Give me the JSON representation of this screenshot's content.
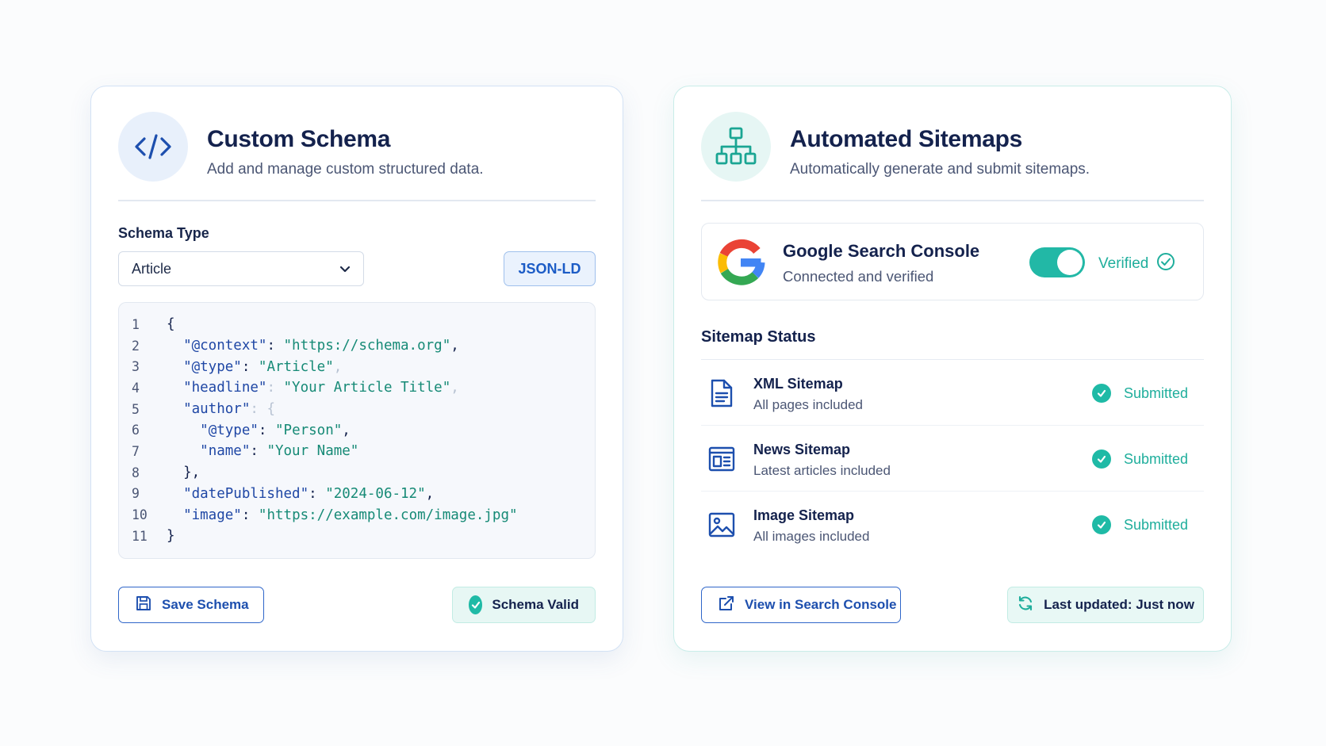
{
  "schema_card": {
    "title": "Custom Schema",
    "subtitle": "Add and manage custom structured data.",
    "icon": "code-icon",
    "schema_type_label": "Schema Type",
    "schema_type_value": "Article",
    "format_badge": "JSON-LD",
    "code_lines": [
      {
        "n": "1",
        "indent": "",
        "parts": [
          [
            "p",
            "{"
          ]
        ]
      },
      {
        "n": "2",
        "indent": "  ",
        "parts": [
          [
            "k",
            "\"@context\""
          ],
          [
            "p",
            ": "
          ],
          [
            "s",
            "\"https://schema.org\""
          ],
          [
            "p",
            ","
          ]
        ]
      },
      {
        "n": "3",
        "indent": "  ",
        "parts": [
          [
            "k",
            "\"@type\""
          ],
          [
            "p",
            ": "
          ],
          [
            "s",
            "\"Article\""
          ],
          [
            "fade",
            ","
          ]
        ]
      },
      {
        "n": "4",
        "indent": "  ",
        "parts": [
          [
            "k",
            "\"headline\""
          ],
          [
            "fade",
            ": "
          ],
          [
            "s",
            "\"Your Article Title\""
          ],
          [
            "fade",
            ","
          ]
        ]
      },
      {
        "n": "5",
        "indent": "  ",
        "parts": [
          [
            "k",
            "\"author\""
          ],
          [
            "fade",
            ": {"
          ]
        ]
      },
      {
        "n": "6",
        "indent": "    ",
        "parts": [
          [
            "k",
            "\"@type\""
          ],
          [
            "p",
            ": "
          ],
          [
            "s",
            "\"Person\""
          ],
          [
            "p",
            ","
          ]
        ]
      },
      {
        "n": "7",
        "indent": "    ",
        "parts": [
          [
            "k",
            "\"name\""
          ],
          [
            "p",
            ": "
          ],
          [
            "s",
            "\"Your Name\""
          ]
        ]
      },
      {
        "n": "8",
        "indent": "  ",
        "parts": [
          [
            "p",
            "},"
          ]
        ]
      },
      {
        "n": "9",
        "indent": "  ",
        "parts": [
          [
            "k",
            "\"datePublished\""
          ],
          [
            "p",
            ": "
          ],
          [
            "s",
            "\"2024-06-12\""
          ],
          [
            "p",
            ","
          ]
        ]
      },
      {
        "n": "10",
        "indent": "  ",
        "parts": [
          [
            "k",
            "\"image\""
          ],
          [
            "p",
            ": "
          ],
          [
            "s",
            "\"https://example.com/image.jpg\""
          ]
        ]
      },
      {
        "n": "11",
        "indent": "",
        "parts": [
          [
            "p",
            "}"
          ]
        ]
      }
    ],
    "save_button": "Save Schema",
    "valid_badge": "Schema Valid"
  },
  "sitemaps_card": {
    "title": "Automated Sitemaps",
    "subtitle": "Automatically generate and submit sitemaps.",
    "icon": "sitemap-icon",
    "gsc": {
      "title": "Google Search Console",
      "subtitle": "Connected and verified",
      "toggle_on": true,
      "status": "Verified"
    },
    "section_title": "Sitemap Status",
    "sitemaps": [
      {
        "name": "XML Sitemap",
        "desc": "All pages included",
        "status": "Submitted",
        "icon": "document-icon"
      },
      {
        "name": "News Sitemap",
        "desc": "Latest articles included",
        "status": "Submitted",
        "icon": "news-icon"
      },
      {
        "name": "Image Sitemap",
        "desc": "All images included",
        "status": "Submitted",
        "icon": "image-icon"
      }
    ],
    "view_button": "View in Search Console",
    "updated_badge": "Last updated: Just now"
  },
  "colors": {
    "primary_blue": "#1d4fae",
    "teal": "#1fae9c",
    "text_dark": "#14224d"
  }
}
